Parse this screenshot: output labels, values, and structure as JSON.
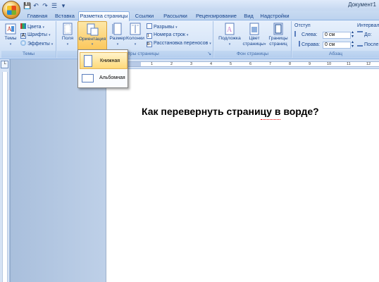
{
  "window": {
    "doc_title": "Документ1"
  },
  "qat": [
    {
      "name": "save-icon",
      "glyph": "💾"
    },
    {
      "name": "undo-icon",
      "glyph": "↶"
    },
    {
      "name": "redo-icon",
      "glyph": "↷"
    },
    {
      "name": "list-icon",
      "glyph": "☰"
    },
    {
      "name": "qat-dropdown-icon",
      "glyph": "▾"
    }
  ],
  "tabs": [
    "Главная",
    "Вставка",
    "Разметка страницы",
    "Ссылки",
    "Рассылки",
    "Рецензирование",
    "Вид",
    "Надстройки"
  ],
  "groups": {
    "themes": {
      "label": "Темы",
      "themes_btn": "Темы",
      "colors": "Цвета",
      "fonts": "Шрифты",
      "effects": "Эффекты"
    },
    "page_setup": {
      "label": "Параметры страницы",
      "margins": "Поля",
      "orientation": "Ориентация",
      "size": "Размер",
      "columns": "Колонки",
      "breaks": "Разрывы",
      "line_numbers": "Номера строк",
      "hyphenation": "Расстановка переносов"
    },
    "page_background": {
      "label": "Фон страницы",
      "watermark": "Подложка",
      "page_color_1": "Цвет",
      "page_color_2": "страницы",
      "borders_1": "Границы",
      "borders_2": "страниц"
    },
    "paragraph": {
      "label": "Абзац",
      "indent": "Отступ",
      "left": "Слева:",
      "right": "Справа:",
      "left_val": "0 см",
      "right_val": "0 см",
      "spacing": "Интервал",
      "before": "До:",
      "after": "После"
    }
  },
  "orientation_menu": {
    "portrait": "Книжная",
    "landscape": "Альбомная"
  },
  "ruler": {
    "marks": [
      "1",
      "2",
      "3",
      "4",
      "5",
      "6",
      "7",
      "8",
      "9",
      "10",
      "11",
      "12"
    ]
  },
  "document": {
    "heading": "Как перевернуть страницу в ворде?"
  },
  "colors": {
    "accent": "#15428b",
    "highlight": "#ffd978"
  }
}
